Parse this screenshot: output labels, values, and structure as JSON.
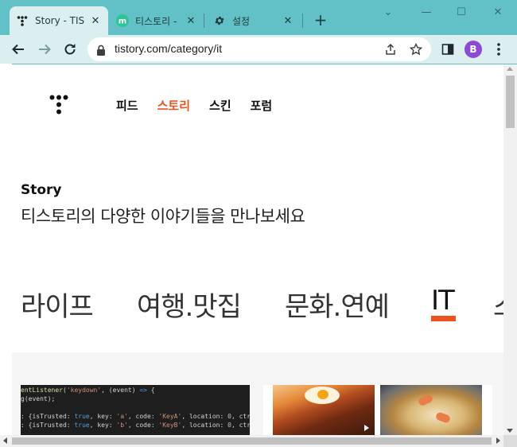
{
  "browser": {
    "tabs": [
      {
        "title": "Story - TISTORY",
        "favicon": "tistory-dots-icon",
        "active": true
      },
      {
        "title": "티스토리 - IT",
        "favicon": "green-m-icon",
        "active": false
      },
      {
        "title": "설정",
        "favicon": "gear-icon",
        "active": false
      }
    ],
    "new_tab_label": "+",
    "url": "tistory.com/category/it",
    "profile_initial": "B",
    "colors": {
      "frame": "#62c1c7",
      "toolbar": "#dbeff0",
      "profile": "#8c4bd4"
    }
  },
  "site": {
    "nav": [
      {
        "label": "피드",
        "active": false
      },
      {
        "label": "스토리",
        "active": true
      },
      {
        "label": "스킨",
        "active": false
      },
      {
        "label": "포럼",
        "active": false
      }
    ],
    "story_heading": "Story",
    "story_subheading": "티스토리의 다양한 이야기들을 만나보세요",
    "categories": [
      {
        "label": "라이프",
        "active": false
      },
      {
        "label": "여행.맛집",
        "active": false
      },
      {
        "label": "문화.연예",
        "active": false
      },
      {
        "label": "IT",
        "active": true
      },
      {
        "label": "스",
        "active": false
      }
    ],
    "accent_color": "#eb531f",
    "code_preview": [
      "entListener('keydown', (event) => {",
      "g(event);",
      "",
      ": {isTrusted: true, key: 'a', code: 'KeyA', location: 0, ctrlKey: fa",
      ": {isTrusted: true, key: 'b', code: 'KeyB', location: 0, ctrlKey: fa"
    ]
  }
}
